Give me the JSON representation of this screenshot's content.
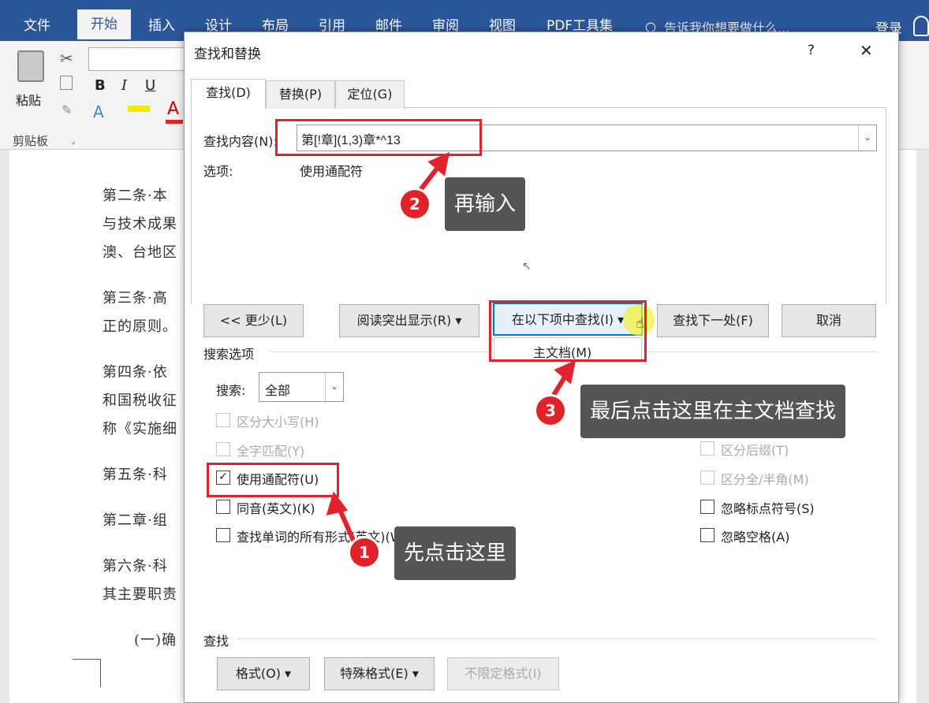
{
  "ribbon": {
    "tabs": [
      "文件",
      "开始",
      "插入",
      "设计",
      "布局",
      "引用",
      "邮件",
      "审阅",
      "视图",
      "PDF工具集"
    ],
    "tellme": "告诉我你想要做什么...",
    "login": "登录",
    "paste_label": "粘贴",
    "clipboard_label": "剪贴板",
    "bold": "B",
    "italic": "I",
    "underline": "U"
  },
  "document": {
    "lines": [
      "第二条·本",
      "与技术成果",
      "澳、台地区",
      "第三条·高",
      "正的原则。",
      "第四条·依",
      "和国税收征",
      "称《实施细",
      "第五条·科",
      "第二章·组",
      "第六条·科",
      "其主要职责",
      "(一)确"
    ]
  },
  "dialog": {
    "title": "查找和替换",
    "help": "?",
    "close": "✕",
    "tabs": [
      "查找(D)",
      "替换(P)",
      "定位(G)"
    ],
    "find_label": "查找内容(N):",
    "find_value": "第[!章](1,3)章*^13",
    "options_label": "选项:",
    "options_value": "使用通配符",
    "buttons": {
      "less": "<< 更少(L)",
      "reading_highlight": "阅读突出显示(R) ▾",
      "find_in": "在以下项中查找(I) ▾",
      "find_next": "查找下一处(F)",
      "cancel": "取消"
    },
    "dropdown_item": "主文档(M)",
    "search_options_heading": "搜索选项",
    "search_label": "搜索:",
    "search_value": "全部",
    "left_options": [
      {
        "label": "区分大小写(H)",
        "checked": false,
        "disabled": true
      },
      {
        "label": "全字匹配(Y)",
        "checked": false,
        "disabled": true
      },
      {
        "label": "使用通配符(U)",
        "checked": true,
        "disabled": false
      },
      {
        "label": "同音(英文)(K)",
        "checked": false,
        "disabled": false
      },
      {
        "label": "查找单词的所有形式(英文)(W)",
        "checked": false,
        "disabled": false
      }
    ],
    "right_options": [
      {
        "label": "区分后缀(T)",
        "checked": false,
        "disabled": true
      },
      {
        "label": "区分全/半角(M)",
        "checked": false,
        "disabled": true
      },
      {
        "label": "忽略标点符号(S)",
        "checked": false,
        "disabled": false
      },
      {
        "label": "忽略空格(A)",
        "checked": false,
        "disabled": false
      }
    ],
    "find_section": "查找",
    "bottom_buttons": {
      "format": "格式(O) ▾",
      "special": "特殊格式(E) ▾",
      "no_format": "不限定格式(I)"
    }
  },
  "annotations": {
    "step1_number": "1",
    "step1_text": "先点击这里",
    "step2_number": "2",
    "step2_text": "再输入",
    "step3_number": "3",
    "step3_text": "最后点击这里在主文档查找"
  },
  "colors": {
    "accent": "#2b579a",
    "annotation_red": "#e0232a",
    "callout_bg": "#555555"
  }
}
